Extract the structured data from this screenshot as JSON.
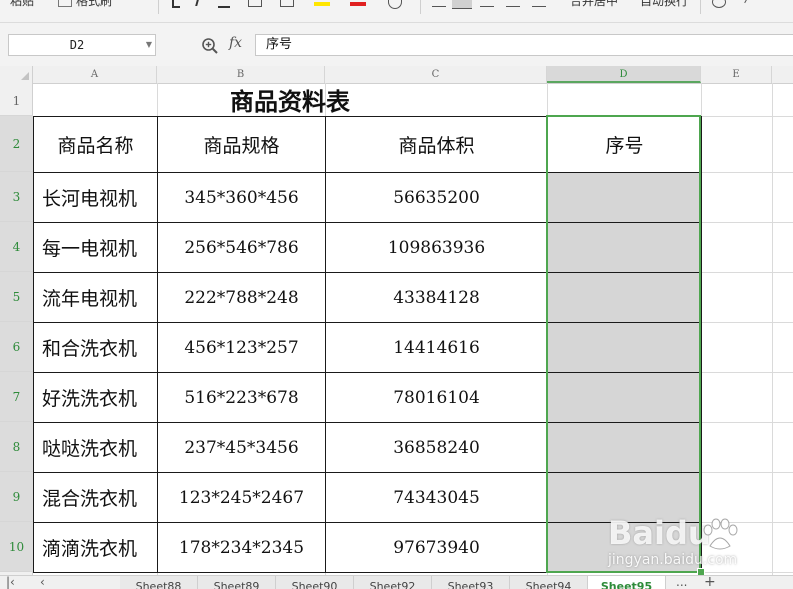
{
  "ribbon": {
    "paste_label": "粘贴",
    "format_painter_label": "格式刷",
    "merge_center_label": "合并居中",
    "wrap_text_label": "自动换行"
  },
  "formula_bar": {
    "cell_ref": "D2",
    "fx_label": "fx",
    "formula_value": "序号"
  },
  "columns": [
    "A",
    "B",
    "C",
    "D",
    "E"
  ],
  "active_column": "D",
  "rows": [
    "1",
    "2",
    "3",
    "4",
    "5",
    "6",
    "7",
    "8",
    "9",
    "10"
  ],
  "sheet": {
    "title": "商品资料表",
    "headers": [
      "商品名称",
      "商品规格",
      "商品体积",
      "序号"
    ],
    "data": [
      [
        "长河电视机",
        "345*360*456",
        "56635200",
        ""
      ],
      [
        "每一电视机",
        "256*546*786",
        "109863936",
        ""
      ],
      [
        "流年电视机",
        "222*788*248",
        "43384128",
        ""
      ],
      [
        "和合洗衣机",
        "456*123*257",
        "14414616",
        ""
      ],
      [
        "好洗洗衣机",
        "516*223*678",
        "78016104",
        ""
      ],
      [
        "哒哒洗衣机",
        "237*45*3456",
        "36858240",
        ""
      ],
      [
        "混合洗衣机",
        "123*245*2467",
        "74343045",
        ""
      ],
      [
        "滴滴洗衣机",
        "178*234*2345",
        "97673940",
        ""
      ]
    ]
  },
  "sheet_tabs": [
    "Sheet88",
    "Sheet89",
    "Sheet90",
    "Sheet92",
    "Sheet93",
    "Sheet94",
    "Sheet95"
  ],
  "active_sheet": "Sheet95",
  "more_tabs_label": "...",
  "add_sheet_label": "+",
  "watermark": {
    "brand": "Baidu",
    "url": "jingyan.baidu.com"
  },
  "colors": {
    "selection": "#4ea64f",
    "selection_fill": "#d6d6d6",
    "active_header_text": "#2e8b3a"
  }
}
